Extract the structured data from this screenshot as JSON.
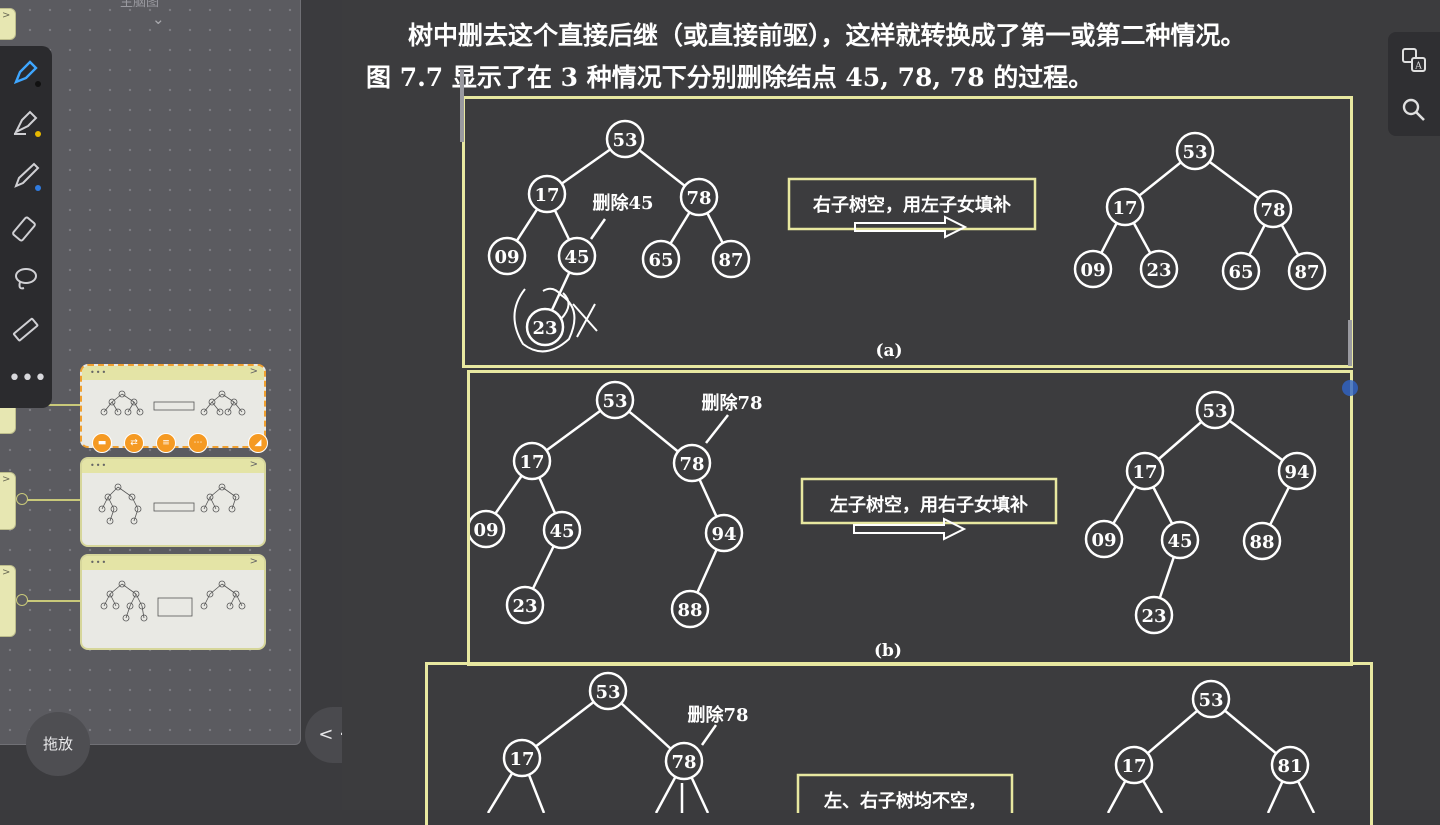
{
  "sidebar": {
    "canvas_title": "主脑图",
    "drag_label": "拖放",
    "nav_label": "< · >",
    "edge_arrow": ">",
    "thumb_dots": "•••",
    "thumb_chevron": ">"
  },
  "document": {
    "line_top_partial": "树中删去这个直接后继（或直接前驱），这样就转换成了第一或第二种情况。",
    "line_caption": "图 7.7 显示了在 3 种情况下分别删除结点 45, 78, 78 的过程。",
    "figures": {
      "a": {
        "caption": "(a)",
        "label": "删除45",
        "rule": "右子树空，用左子女填补",
        "before_nodes": [
          "53",
          "17",
          "78",
          "09",
          "45",
          "65",
          "87",
          "23"
        ],
        "after_nodes": [
          "53",
          "17",
          "78",
          "09",
          "23",
          "65",
          "87"
        ]
      },
      "b": {
        "caption": "(b)",
        "label": "删除78",
        "rule": "左子树空，用右子女填补",
        "before_nodes": [
          "53",
          "17",
          "78",
          "09",
          "45",
          "94",
          "23",
          "88"
        ],
        "after_nodes": [
          "53",
          "17",
          "94",
          "09",
          "45",
          "88",
          "23"
        ]
      },
      "c": {
        "label": "删除78",
        "rule": "左、右子树均不空，",
        "before_nodes": [
          "53",
          "17",
          "78"
        ],
        "after_nodes": [
          "53",
          "17",
          "81"
        ]
      }
    }
  },
  "right_toolbar": {
    "translate_icon": "translate-icon",
    "search_icon": "search-icon"
  }
}
